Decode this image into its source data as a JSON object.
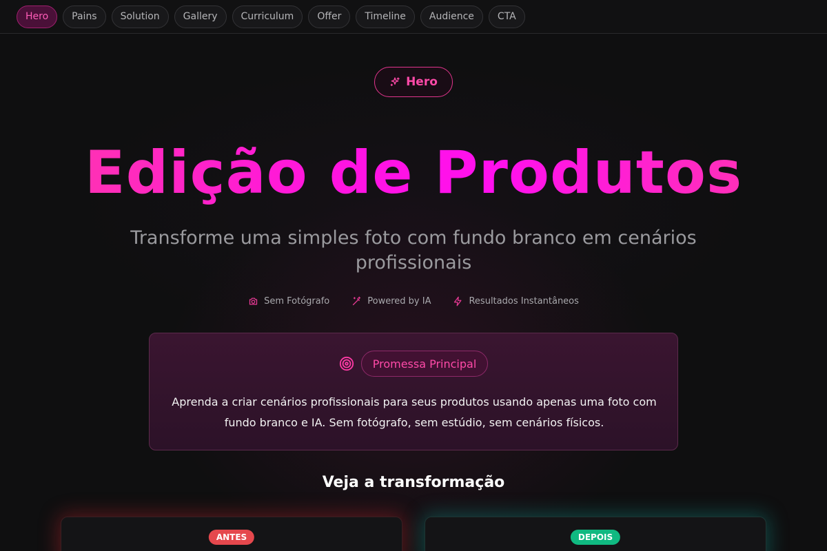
{
  "nav": {
    "items": [
      {
        "label": "Hero",
        "active": true
      },
      {
        "label": "Pains"
      },
      {
        "label": "Solution"
      },
      {
        "label": "Gallery"
      },
      {
        "label": "Curriculum"
      },
      {
        "label": "Offer"
      },
      {
        "label": "Timeline"
      },
      {
        "label": "Audience"
      },
      {
        "label": "CTA"
      }
    ]
  },
  "hero": {
    "badge_label": "Hero",
    "badge_icon": "sparkles-icon",
    "title": "Edição de Produtos",
    "subtitle": "Transforme uma simples foto com fundo branco em cenários profissionais",
    "features": [
      {
        "icon": "camera-icon",
        "label": "Sem Fotógrafo"
      },
      {
        "icon": "magic-wand-icon",
        "label": "Powered by IA"
      },
      {
        "icon": "zap-icon",
        "label": "Resultados Instantâneos"
      }
    ]
  },
  "promise": {
    "icon": "target-icon",
    "label": "Promessa Principal",
    "text": "Aprenda a criar cenários profissionais para seus produtos usando apenas uma foto com fundo branco e IA. Sem fotógrafo, sem estúdio, sem cenários físicos."
  },
  "transformation": {
    "title": "Veja a transformação",
    "before_label": "ANTES",
    "after_label": "DEPOIS"
  },
  "colors": {
    "accent": "#ff3aa6",
    "before": "#e5484d",
    "after": "#10b981"
  }
}
